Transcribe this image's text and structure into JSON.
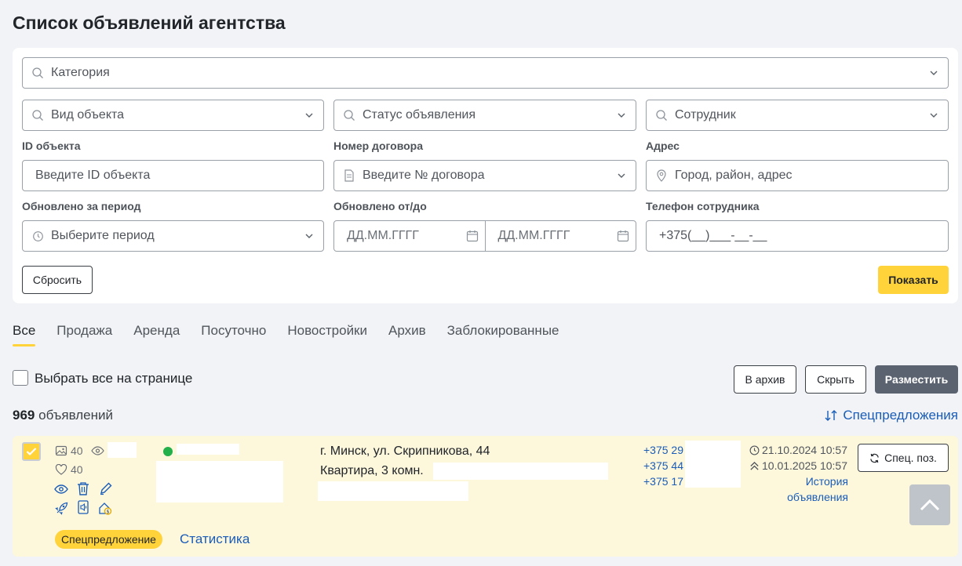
{
  "page": {
    "title": "Список объявлений агентства"
  },
  "filters": {
    "category": {
      "placeholder": "Категория"
    },
    "object_type": {
      "placeholder": "Вид объекта"
    },
    "ad_status": {
      "placeholder": "Статус объявления"
    },
    "employee": {
      "placeholder": "Сотрудник"
    },
    "object_id": {
      "label": "ID объекта",
      "placeholder": "Введите ID объекта"
    },
    "contract": {
      "label": "Номер договора",
      "placeholder": "Введите № договора"
    },
    "address": {
      "label": "Адрес",
      "placeholder": "Город, район, адрес"
    },
    "period": {
      "label": "Обновлено за период",
      "placeholder": "Выберите период"
    },
    "updated_range": {
      "label": "Обновлено от/до",
      "from_placeholder": "ДД.ММ.ГГГГ",
      "to_placeholder": "ДД.ММ.ГГГГ"
    },
    "employee_phone": {
      "label": "Телефон сотрудника",
      "placeholder": "+375(__)___-__-__"
    },
    "reset_label": "Сбросить",
    "show_label": "Показать"
  },
  "tabs": [
    {
      "label": "Все",
      "active": true
    },
    {
      "label": "Продажа"
    },
    {
      "label": "Аренда"
    },
    {
      "label": "Посуточно"
    },
    {
      "label": "Новостройки"
    },
    {
      "label": "Архив"
    },
    {
      "label": "Заблокированные"
    }
  ],
  "bulk": {
    "select_all_label": "Выбрать все на странице",
    "archive_label": "В архив",
    "hide_label": "Скрыть",
    "publish_label": "Разместить"
  },
  "results": {
    "count": "969",
    "count_suffix": "объявлений",
    "sort_label": "Спецпредложения"
  },
  "listing": {
    "photos": "40",
    "favorites": "40",
    "address": "г. Минск, ул. Скрипникова, 44",
    "kind": "Квартира, 3 комн.",
    "phones": [
      "+375 29",
      "+375 44",
      "+375 17"
    ],
    "created": "21.10.2024 10:57",
    "updated": "10.01.2025 10:57",
    "history_label": "История объявления",
    "special_position_label": "Спец. поз.",
    "badge": "Спецпредложение",
    "stats_label": "Статистика",
    "colors": {
      "status_dot": "#23b04a",
      "accent": "#ffd339",
      "link": "#1a5db8"
    }
  }
}
